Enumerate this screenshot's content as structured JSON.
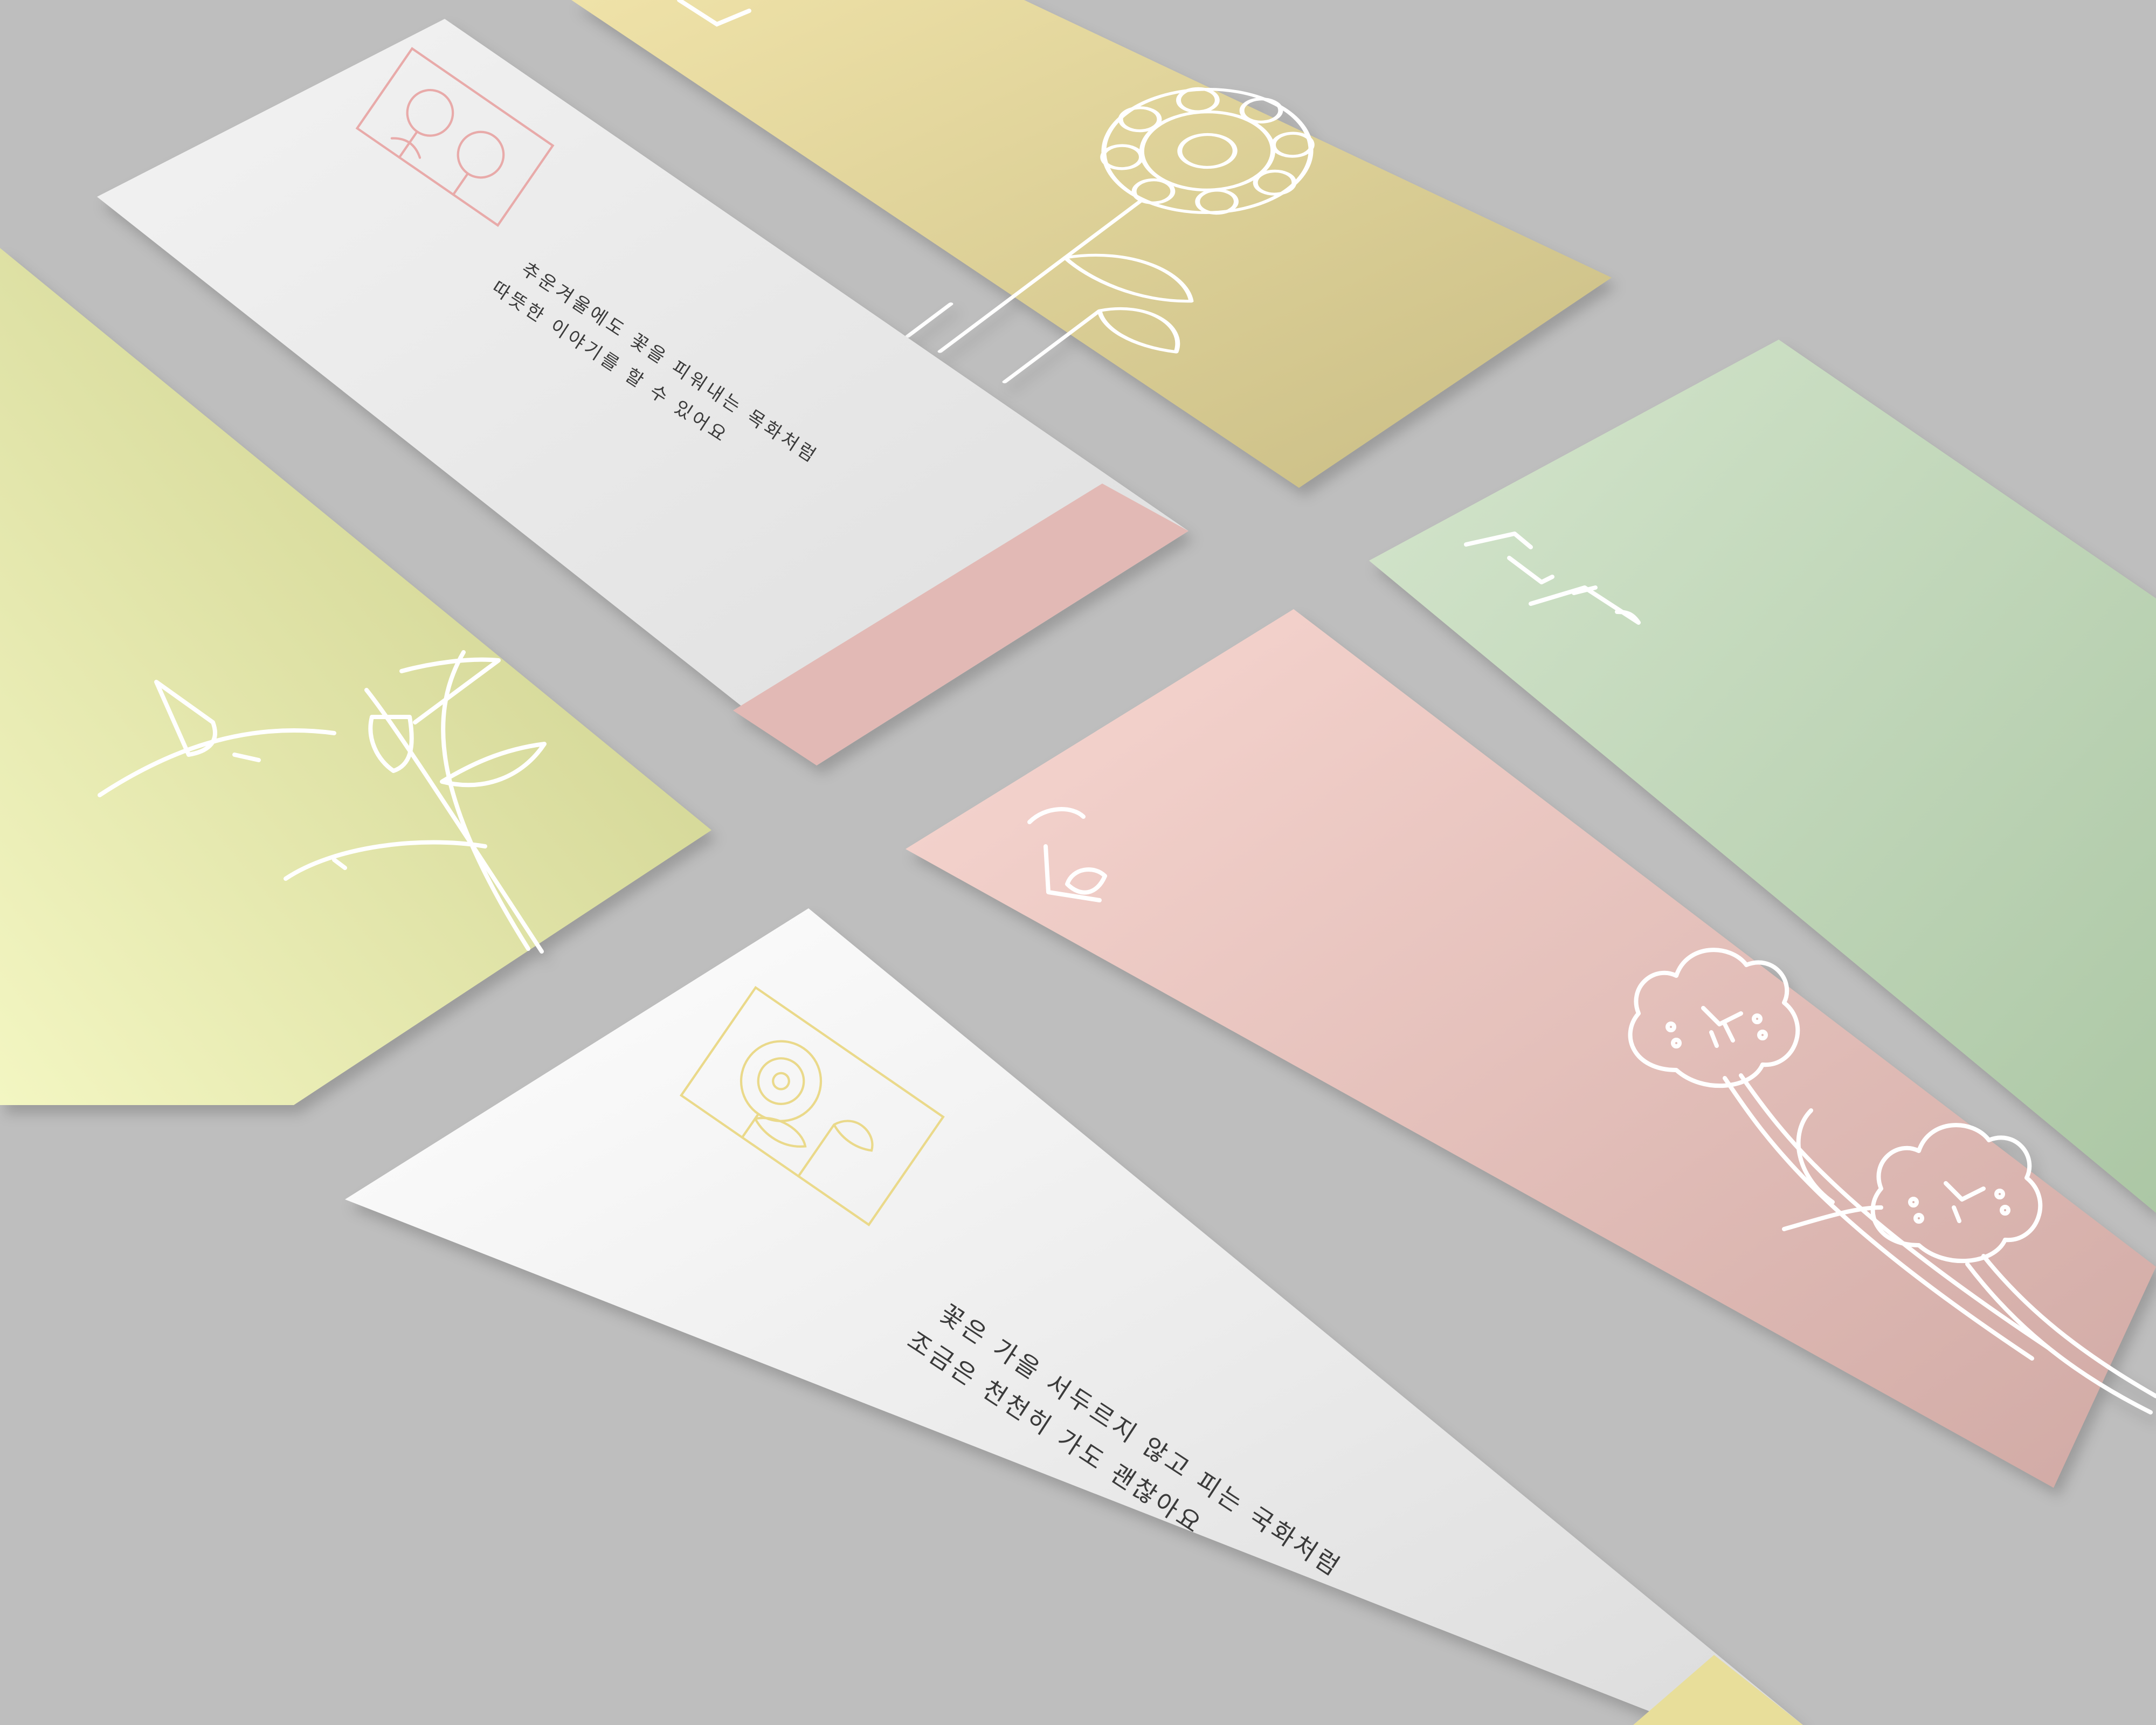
{
  "scene": {
    "title": "Floral stationery card mockup",
    "background_color": "#bebebe"
  },
  "cards": [
    {
      "name": "yellow-card-top",
      "colors": [
        "#efe2a8",
        "#c9bd85"
      ],
      "motif": "chrysanthemum-line-icon",
      "ink": "#ffffff"
    },
    {
      "name": "white-card-top",
      "colors": [
        "#f3f3f3",
        "#dedede"
      ],
      "band_color": "#e2b9b5",
      "frame_color": "#e8aaa9",
      "motif": "cotton-flower-frame-icon",
      "text_lines": [
        "추운겨울에도 꽃을 피워내는 목화처럼",
        "따뜻한 이야기를 할 수 있어요"
      ]
    },
    {
      "name": "lime-card-left",
      "colors": [
        "#f3f6c2",
        "#c8cb86"
      ],
      "motif": "leaf-branch-line-icon",
      "ink": "#ffffff"
    },
    {
      "name": "mint-card-right",
      "colors": [
        "#d5e6cd",
        "#acc7a5"
      ],
      "motif": "hangul-calligraphy-icon",
      "ink": "#ffffff"
    },
    {
      "name": "pink-card-center",
      "colors": [
        "#f8d7d1",
        "#d1aaa5"
      ],
      "motif": "cotton-flower-line-icon",
      "ink": "#ffffff"
    },
    {
      "name": "white-card-bottom",
      "colors": [
        "#ffffff",
        "#dcdcdc"
      ],
      "band_color": "#e8de9a",
      "frame_color": "#ead98a",
      "motif": "chrysanthemum-frame-icon",
      "text_lines": [
        "꽃은 가을 서두르지 않고 피는 국화처럼",
        "조금은 천천히 가도 괜찮아요"
      ]
    }
  ]
}
